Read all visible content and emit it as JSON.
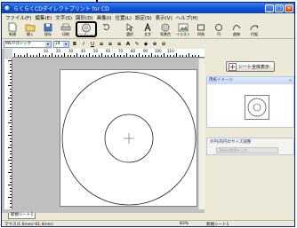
{
  "window": {
    "title": "らくらくCDダイレクトプリント for CD"
  },
  "menu": {
    "items": [
      "ファイル(F)",
      "編集(E)",
      "文字(S)",
      "図形(D)",
      "画像(I)",
      "位置(L)",
      "設定(S)",
      "表示(V)",
      "ヘルプ(H)"
    ]
  },
  "toolbar": {
    "tools": [
      {
        "label": "新規",
        "icon": "new-doc-icon"
      },
      {
        "label": "開く",
        "icon": "open-folder-icon"
      },
      {
        "label": "保存",
        "icon": "save-icon"
      },
      {
        "label": "印刷",
        "icon": "print-icon"
      },
      {
        "label": "テンプレート",
        "icon": "cd-template-icon"
      },
      {
        "label": "",
        "icon": "rotate-icon"
      },
      {
        "label": "選択",
        "icon": "pointer-icon"
      },
      {
        "label": "文字",
        "icon": "text-icon"
      },
      {
        "label": "背景色",
        "icon": "background-icon"
      },
      {
        "label": "イラスト",
        "icon": "illustration-icon"
      },
      {
        "label": "四角",
        "icon": "rectangle-icon"
      },
      {
        "label": "円",
        "icon": "circle-icon"
      },
      {
        "label": "曲線",
        "icon": "curve-icon"
      },
      {
        "label": "円弧",
        "icon": "arc-icon"
      }
    ]
  },
  "format": {
    "font": "MS Pゴシック",
    "size": "24"
  },
  "ruler": {
    "top_numbers": [
      "10",
      "20",
      "30",
      "40",
      "50",
      "60",
      "70",
      "80",
      "90",
      "100",
      "110"
    ]
  },
  "sheet": {
    "tab": "新規シート1"
  },
  "status": {
    "coords": "マウス(1.0mm/-61.4mm)",
    "zoom": "83%",
    "sheet": "新規シート1"
  },
  "panel": {
    "sheet_button": "シート全体表示",
    "image_header": "用紙イメージ",
    "adjust_header": "外円/内円のサイズ調整",
    "adjust_placeholder": "直径の数値を入力"
  },
  "colors": {
    "titlebar": "#0a4fd6",
    "workspace": "#c0c0c0",
    "panel_header": "#c6d6f5"
  }
}
